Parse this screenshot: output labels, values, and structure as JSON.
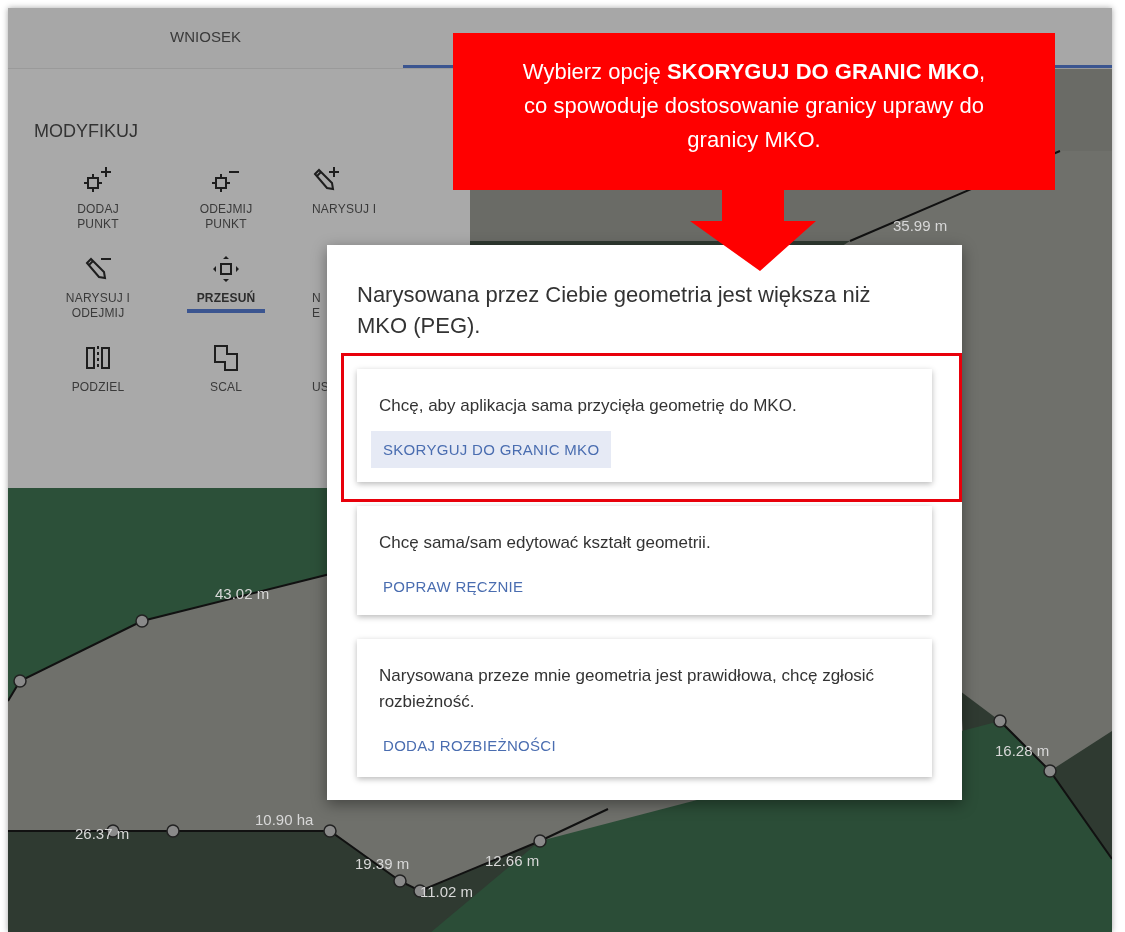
{
  "tabs": [
    {
      "label": "WNIOSEK",
      "selected": false
    },
    {
      "selected": true
    }
  ],
  "panel": {
    "title": "MODYFIKUJ",
    "tools": [
      {
        "lines": [
          "DODAJ",
          "PUNKT"
        ],
        "selected": false
      },
      {
        "lines": [
          "ODEJMIJ",
          "PUNKT"
        ],
        "selected": false
      },
      {
        "lines": [
          "NARYSUJ I"
        ],
        "selected": false
      },
      {
        "lines": [
          "NARYSUJ I",
          "ODEJMIJ"
        ],
        "selected": false
      },
      {
        "lines": [
          "PRZESUŃ"
        ],
        "selected": true
      },
      {
        "lines": [
          "N",
          "E"
        ],
        "selected": false
      },
      {
        "lines": [
          "PODZIEL"
        ],
        "selected": false
      },
      {
        "lines": [
          "SCAL"
        ],
        "selected": false
      },
      {
        "lines": [
          "US"
        ],
        "selected": false
      }
    ]
  },
  "map": {
    "labels": [
      "35.99 m",
      "43.02 m",
      "26.37 m",
      "10.90 ha",
      "19.39 m",
      "12.66 m",
      "11.02 m",
      "16.28 m"
    ]
  },
  "dialog": {
    "title": "Narysowana przez Ciebie geometria jest większa niż MKO (PEG).",
    "options": [
      {
        "text": "Chcę, aby aplikacja sama przycięła geometrię do MKO.",
        "action": "SKORYGUJ DO GRANIC MKO",
        "highlighted": true
      },
      {
        "text": "Chcę sama/sam edytować kształt geometrii.",
        "action": "POPRAW RĘCZNIE",
        "highlighted": false
      },
      {
        "text": "Narysowana przeze mnie geometria jest prawidłowa, chcę zgłosić rozbieżność.",
        "action": "DODAJ ROZBIEŻNOŚCI",
        "highlighted": false
      }
    ]
  },
  "callout": {
    "text": "Wybierz opcję **SKORYGUJ DO GRANIC MKO**, co spowoduje dostosowanie granicy uprawy do granicy MKO."
  }
}
